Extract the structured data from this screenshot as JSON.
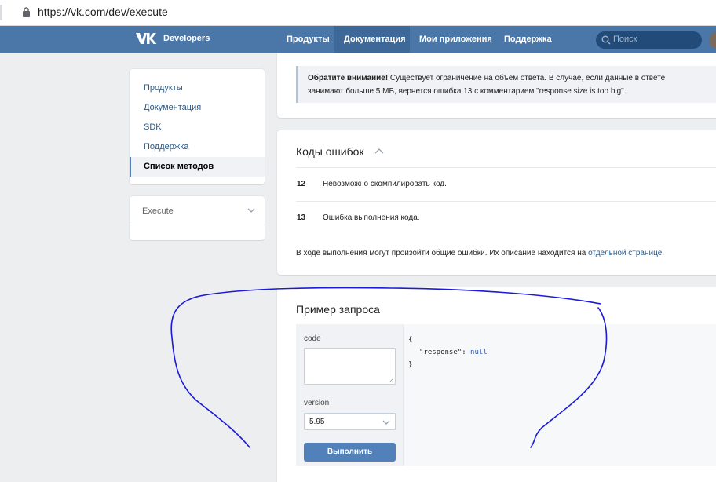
{
  "browser": {
    "url": "https://vk.com/dev/execute"
  },
  "header": {
    "brand": "Developers",
    "nav": [
      "Продукты",
      "Документация",
      "Мои приложения",
      "Поддержка"
    ],
    "active_nav": "Документация",
    "search_placeholder": "Поиск",
    "accent_color": "#4a76a8"
  },
  "sidebar": {
    "items": [
      {
        "label": "Продукты"
      },
      {
        "label": "Документация"
      },
      {
        "label": "SDK"
      },
      {
        "label": "Поддержка"
      },
      {
        "label": "Список методов",
        "active": true
      }
    ],
    "method_select": "Execute"
  },
  "notice": {
    "bold": "Обратите внимание!",
    "text_line1": " Существует ограничение на объем ответа. В случае, если данные в ответе",
    "text_line2": "занимают больше 5 МБ, вернется ошибка 13 с комментарием \"response size is too big\"."
  },
  "errors": {
    "title": "Коды ошибок",
    "rows": [
      {
        "code": "12",
        "desc": "Невозможно скомпилировать код."
      },
      {
        "code": "13",
        "desc": "Ошибка выполнения кода."
      }
    ],
    "note_prefix": "В ходе выполнения могут произойти общие ошибки. Их описание находится на ",
    "note_link": "отдельной странице",
    "note_suffix": "."
  },
  "request": {
    "title": "Пример запроса",
    "code_label": "code",
    "code_value": "",
    "version_label": "version",
    "version_value": "5.95",
    "submit_label": "Выполнить",
    "response_open": "{",
    "response_key": "\"response\"",
    "response_colon": ": ",
    "response_value": "null",
    "response_close": "}"
  },
  "annotation": {
    "stroke_color": "#1a1ad8"
  }
}
